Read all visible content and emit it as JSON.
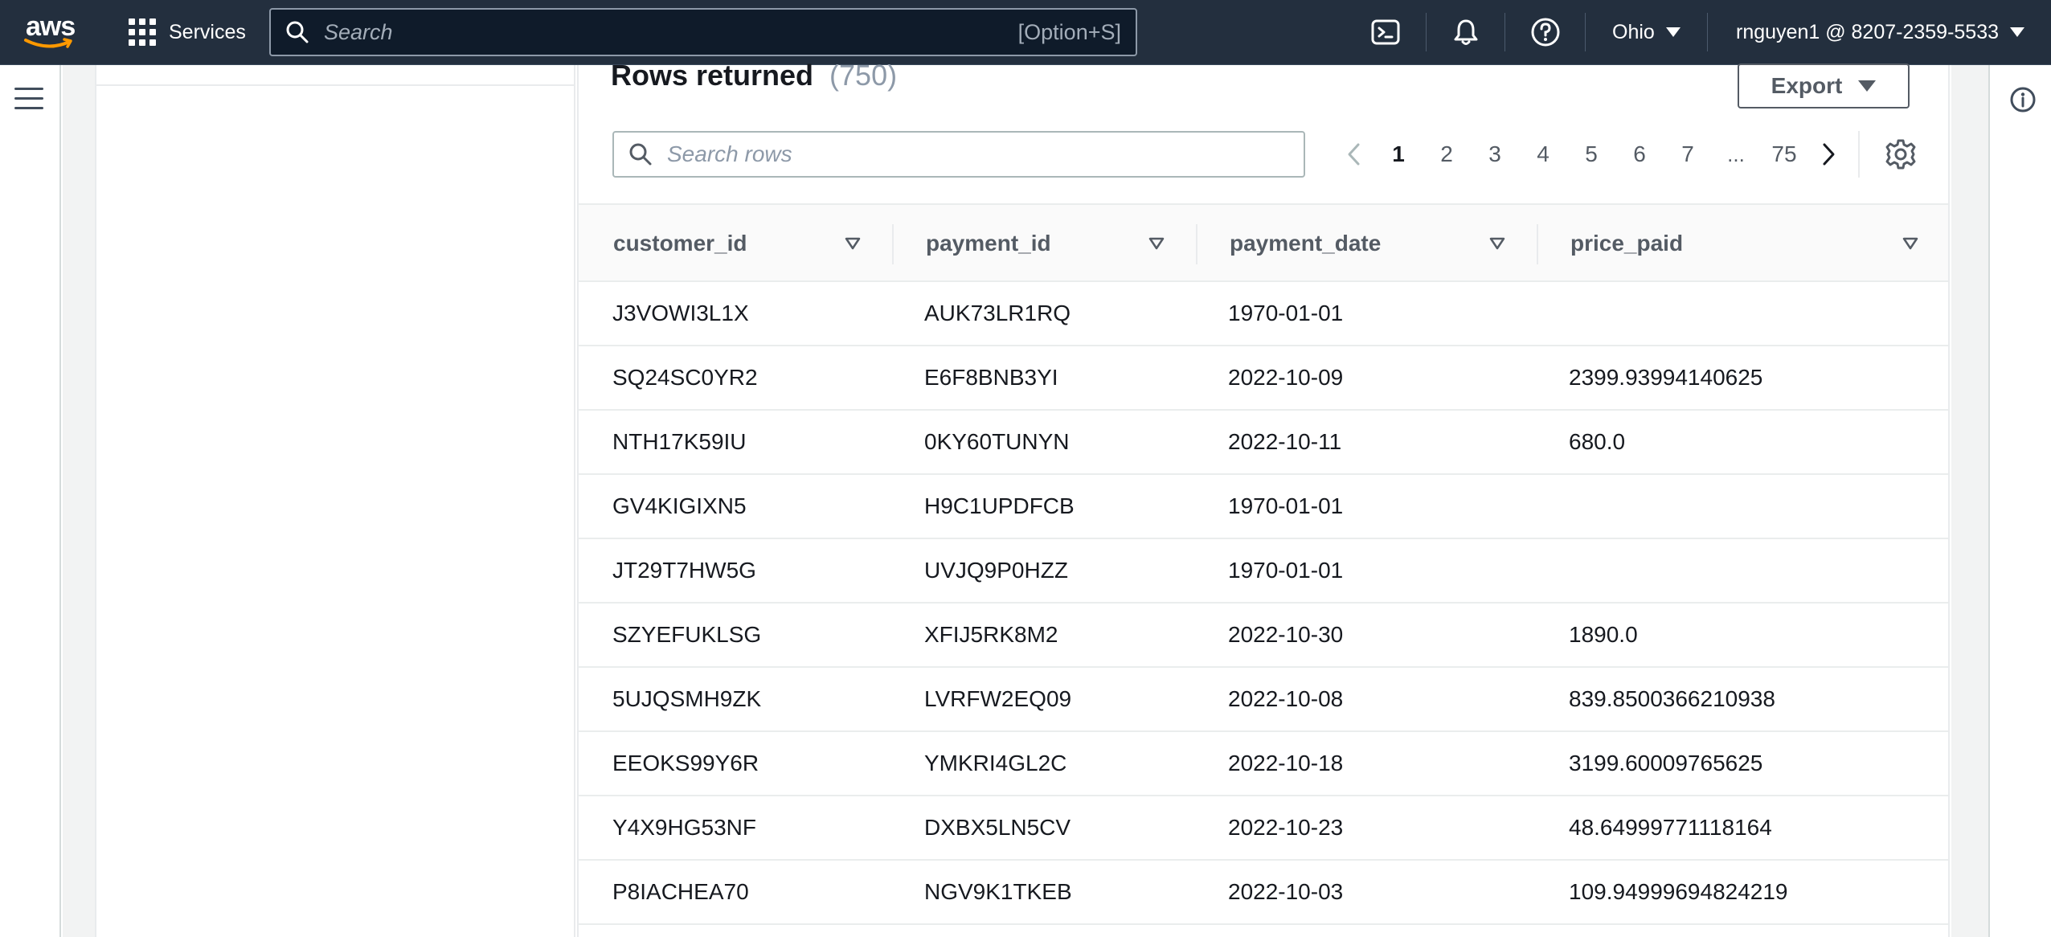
{
  "topnav": {
    "logo_text": "aws",
    "services_label": "Services",
    "search_placeholder": "Search",
    "search_shortcut": "[Option+S]",
    "region": "Ohio",
    "account": "rnguyen1 @ 8207-2359-5533",
    "icons": [
      "cloudshell-icon",
      "bell-icon",
      "help-icon"
    ]
  },
  "results": {
    "title": "Rows returned",
    "count": "(750)",
    "export_label": "Export",
    "search_placeholder": "Search rows",
    "pagination": {
      "pages": [
        "1",
        "2",
        "3",
        "4",
        "5",
        "6",
        "7"
      ],
      "ellipsis": "...",
      "last_page": "75",
      "current": "1"
    }
  },
  "table": {
    "columns": [
      "customer_id",
      "payment_id",
      "payment_date",
      "price_paid"
    ],
    "rows": [
      [
        "J3VOWI3L1X",
        "AUK73LR1RQ",
        "1970-01-01",
        ""
      ],
      [
        "SQ24SC0YR2",
        "E6F8BNB3YI",
        "2022-10-09",
        "2399.93994140625"
      ],
      [
        "NTH17K59IU",
        "0KY60TUNYN",
        "2022-10-11",
        "680.0"
      ],
      [
        "GV4KIGIXN5",
        "H9C1UPDFCB",
        "1970-01-01",
        ""
      ],
      [
        "JT29T7HW5G",
        "UVJQ9P0HZZ",
        "1970-01-01",
        ""
      ],
      [
        "SZYEFUKLSG",
        "XFIJ5RK8M2",
        "2022-10-30",
        "1890.0"
      ],
      [
        "5UJQSMH9ZK",
        "LVRFW2EQ09",
        "2022-10-08",
        "839.8500366210938"
      ],
      [
        "EEOKS99Y6R",
        "YMKRI4GL2C",
        "2022-10-18",
        "3199.60009765625"
      ],
      [
        "Y4X9HG53NF",
        "DXBX5LN5CV",
        "2022-10-23",
        "48.64999771118164"
      ],
      [
        "P8IACHEA70",
        "NGV9K1TKEB",
        "2022-10-03",
        "109.94999694824219"
      ]
    ]
  },
  "colors": {
    "nav_bg": "#232f3e",
    "text_primary": "#16191f",
    "text_secondary": "#545b64",
    "muted": "#8d99a8"
  }
}
